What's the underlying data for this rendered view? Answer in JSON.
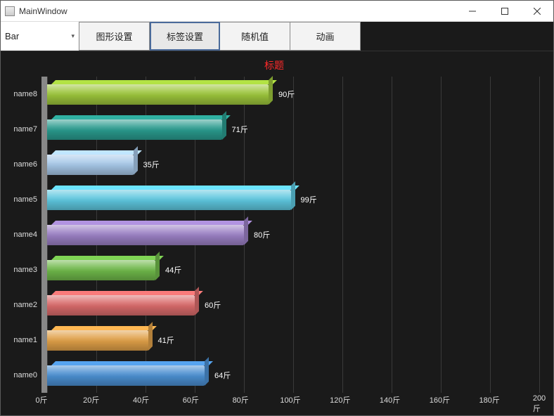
{
  "window": {
    "title": "MainWindow"
  },
  "toolbar": {
    "combo_value": "Bar",
    "buttons": [
      "图形设置",
      "标签设置",
      "随机值",
      "动画"
    ],
    "active_index": 1
  },
  "chart_data": {
    "type": "bar",
    "orientation": "horizontal",
    "title": "标题",
    "unit": "斤",
    "xlim": [
      0,
      200
    ],
    "xticks": [
      0,
      20,
      40,
      60,
      80,
      100,
      120,
      140,
      160,
      180,
      200
    ],
    "categories": [
      "name8",
      "name7",
      "name6",
      "name5",
      "name4",
      "name3",
      "name2",
      "name1",
      "name0"
    ],
    "values": [
      90,
      71,
      35,
      99,
      80,
      44,
      60,
      41,
      64
    ],
    "colors": [
      "#9cc53b",
      "#2a9b8e",
      "#a7c8e8",
      "#5ec7df",
      "#9b80c4",
      "#6fb84a",
      "#d96b6b",
      "#e0a048",
      "#4b8fd1"
    ]
  }
}
